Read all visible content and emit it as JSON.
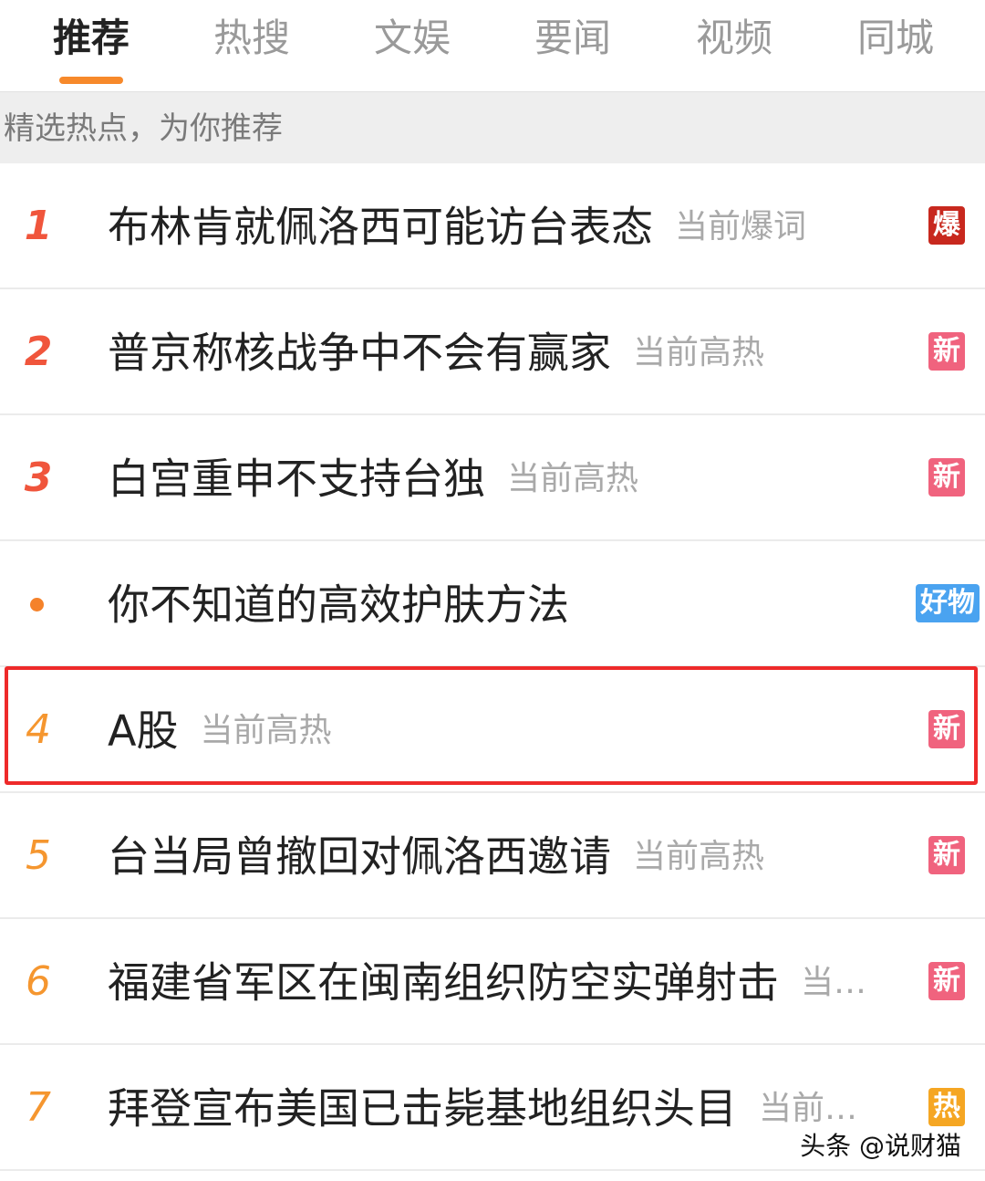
{
  "tabs": [
    {
      "label": "推荐",
      "active": true
    },
    {
      "label": "热搜",
      "active": false
    },
    {
      "label": "文娱",
      "active": false
    },
    {
      "label": "要闻",
      "active": false
    },
    {
      "label": "视频",
      "active": false
    },
    {
      "label": "同城",
      "active": false
    }
  ],
  "subheader": "精选热点，为你推荐",
  "items": [
    {
      "rank": "1",
      "title": "布林肯就佩洛西可能访台表态",
      "heat": "当前爆词",
      "badge": "爆",
      "badge_color": "#c8281e"
    },
    {
      "rank": "2",
      "title": "普京称核战争中不会有赢家",
      "heat": "当前高热",
      "badge": "新",
      "badge_color": "#f0637e"
    },
    {
      "rank": "3",
      "title": "白宫重申不支持台独",
      "heat": "当前高热",
      "badge": "新",
      "badge_color": "#f0637e"
    },
    {
      "rank": "",
      "title": "你不知道的高效护肤方法",
      "heat": "",
      "badge": "好物",
      "badge_color": "#4aa3f0"
    },
    {
      "rank": "4",
      "title": "A股",
      "heat": "当前高热",
      "badge": "新",
      "badge_color": "#f0637e"
    },
    {
      "rank": "5",
      "title": "台当局曾撤回对佩洛西邀请",
      "heat": "当前高热",
      "badge": "新",
      "badge_color": "#f0637e"
    },
    {
      "rank": "6",
      "title": "福建省军区在闽南组织防空实弹射击",
      "heat": "当…",
      "badge": "新",
      "badge_color": "#f0637e"
    },
    {
      "rank": "7",
      "title": "拜登宣布美国已击毙基地组织头目",
      "heat": "当前…",
      "badge": "热",
      "badge_color": "#f5a623"
    }
  ],
  "watermark": "头条 @说财猫",
  "colors": {
    "accent": "#f7892b",
    "highlight_border": "#ee2a2a"
  }
}
